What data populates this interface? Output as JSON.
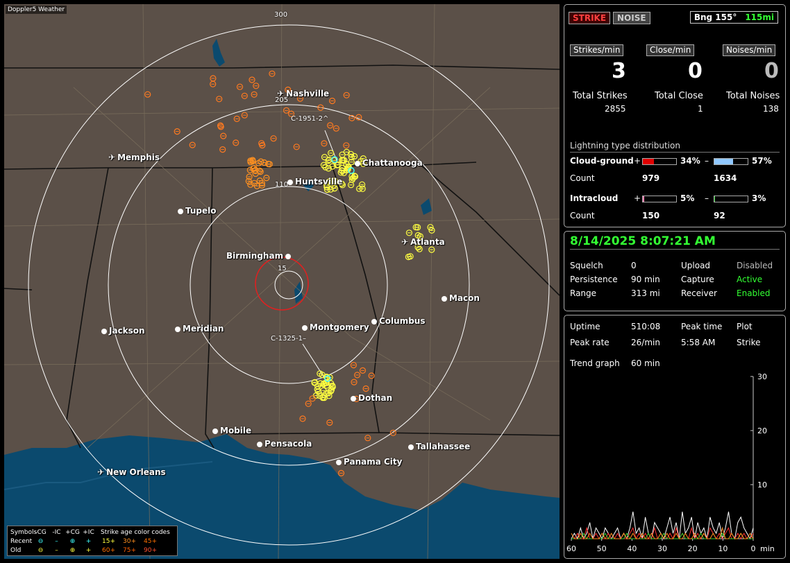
{
  "app": {
    "title": "Doppler5 Weather"
  },
  "map": {
    "range_labels": [
      "300",
      "205",
      "110",
      "15"
    ],
    "storm_labels": [
      "C-1951-2^",
      "C-1325-1–"
    ],
    "cities": [
      {
        "name": "Nashville",
        "airport": true
      },
      {
        "name": "Memphis",
        "airport": true
      },
      {
        "name": "Chattanooga",
        "airport": false
      },
      {
        "name": "Huntsville",
        "airport": false
      },
      {
        "name": "Tupelo",
        "airport": false
      },
      {
        "name": "Atlanta",
        "airport": true
      },
      {
        "name": "Birmingham",
        "airport": false
      },
      {
        "name": "Macon",
        "airport": false
      },
      {
        "name": "Jackson",
        "airport": false
      },
      {
        "name": "Meridian",
        "airport": false
      },
      {
        "name": "Montgomery",
        "airport": false
      },
      {
        "name": "Columbus",
        "airport": false
      },
      {
        "name": "Dothan",
        "airport": false
      },
      {
        "name": "Mobile",
        "airport": false
      },
      {
        "name": "Pensacola",
        "airport": false
      },
      {
        "name": "Tallahassee",
        "airport": false
      },
      {
        "name": "Panama City",
        "airport": false
      },
      {
        "name": "New Orleans",
        "airport": true
      }
    ]
  },
  "legend": {
    "header": [
      "Symbols",
      "-CG",
      "-IC",
      "+CG",
      "+IC",
      "Strike age color codes"
    ],
    "recent_label": "Recent",
    "old_label": "Old",
    "recent_ages": [
      "15+",
      "30+",
      "45+"
    ],
    "old_ages": [
      "60+",
      "75+",
      "90+"
    ],
    "age_colors": [
      "#ffff40",
      "#ff9020",
      "#ff7000",
      "#ff7000",
      "#ff6000",
      "#ff5030"
    ]
  },
  "status": {
    "strike_btn": "STRIKE",
    "noise_btn": "NOISE",
    "bearing": "Bng 155°",
    "distance": "115mi"
  },
  "rates": {
    "strikes_label": "Strikes/min",
    "close_label": "Close/min",
    "noises_label": "Noises/min",
    "strikes": "3",
    "close": "0",
    "noises": "0"
  },
  "totals": {
    "strikes_label": "Total Strikes",
    "close_label": "Total Close",
    "noises_label": "Total Noises",
    "strikes": "2855",
    "close": "1",
    "noises": "138"
  },
  "distribution": {
    "title": "Lightning type distribution",
    "cg_label": "Cloud-ground",
    "ic_label": "Intracloud",
    "count_label": "Count",
    "plus": "+",
    "minus": "–",
    "cg_plus_pct": "34%",
    "cg_minus_pct": "57%",
    "cg_plus_count": "979",
    "cg_minus_count": "1634",
    "ic_plus_pct": "5%",
    "ic_minus_pct": "3%",
    "ic_plus_count": "150",
    "ic_minus_count": "92",
    "cg_plus_fill": 0.34,
    "cg_minus_fill": 0.57,
    "ic_plus_fill": 0.05,
    "ic_minus_fill": 0.03,
    "colors": {
      "cg_plus": "#e00000",
      "cg_minus": "#90c8ff",
      "ic_plus": "#ff80b0",
      "ic_minus": "#30d030"
    }
  },
  "settings": {
    "datetime": "8/14/2025 8:07:21 AM",
    "squelch_label": "Squelch",
    "squelch": "0",
    "persistence_label": "Persistence",
    "persistence": "90 min",
    "range_label": "Range",
    "range": "313 mi",
    "upload_label": "Upload",
    "upload": "Disabled",
    "capture_label": "Capture",
    "capture": "Active",
    "receiver_label": "Receiver",
    "receiver": "Enabled"
  },
  "stats": {
    "uptime_label": "Uptime",
    "uptime": "510:08",
    "peak_time_label": "Peak time",
    "peak_time": "5:58 AM",
    "plot_label": "Plot",
    "plot": "Strike",
    "peak_rate_label": "Peak rate",
    "peak_rate": "26/min",
    "trend_label": "Trend graph",
    "trend": "60 min"
  },
  "chart_data": {
    "type": "line",
    "title": "",
    "xlabel": "min",
    "ylabel": "",
    "x_ticks": [
      "60",
      "50",
      "40",
      "30",
      "20",
      "10",
      "0"
    ],
    "y_ticks": [
      "30",
      "20",
      "10"
    ],
    "xlim": [
      60,
      0
    ],
    "ylim": [
      0,
      30
    ],
    "series": [
      {
        "color": "#ffffff",
        "values": [
          0,
          1,
          0,
          2,
          0,
          1,
          3,
          0,
          2,
          1,
          0,
          2,
          1,
          0,
          1,
          2,
          0,
          1,
          0,
          2,
          5,
          1,
          2,
          0,
          4,
          1,
          0,
          3,
          2,
          1,
          0,
          2,
          4,
          1,
          3,
          0,
          5,
          1,
          2,
          4,
          0,
          3,
          1,
          2,
          0,
          4,
          2,
          1,
          3,
          0,
          2,
          5,
          1,
          0,
          3,
          4,
          2,
          1,
          0,
          2
        ]
      },
      {
        "color": "#ff3030",
        "values": [
          0,
          0,
          1,
          0,
          0,
          2,
          0,
          0,
          1,
          0,
          0,
          0,
          1,
          0,
          0,
          1,
          0,
          0,
          0,
          1,
          2,
          0,
          1,
          0,
          1,
          0,
          0,
          2,
          0,
          0,
          1,
          0,
          1,
          0,
          2,
          0,
          1,
          0,
          0,
          2,
          0,
          1,
          0,
          1,
          0,
          2,
          1,
          0,
          1,
          0,
          1,
          2,
          0,
          0,
          1,
          0,
          1,
          0,
          0,
          1
        ]
      },
      {
        "color": "#30d030",
        "values": [
          0,
          0,
          0,
          0,
          1,
          0,
          0,
          0,
          0,
          0,
          0,
          1,
          0,
          0,
          0,
          0,
          0,
          0,
          1,
          0,
          0,
          0,
          0,
          0,
          0,
          1,
          0,
          0,
          0,
          0,
          1,
          0,
          0,
          0,
          0,
          0,
          1,
          0,
          0,
          0,
          0,
          0,
          1,
          0,
          0,
          0,
          0,
          0,
          0,
          1,
          0,
          0,
          0,
          0,
          0,
          1,
          0,
          0,
          0,
          0
        ]
      },
      {
        "color": "#ff9020",
        "values": [
          1,
          0,
          0,
          1,
          0,
          0,
          1,
          0,
          0,
          0,
          1,
          0,
          0,
          1,
          0,
          0,
          0,
          1,
          0,
          0,
          1,
          0,
          0,
          1,
          0,
          0,
          1,
          0,
          0,
          1,
          0,
          1,
          0,
          0,
          1,
          0,
          0,
          1,
          0,
          0,
          1,
          0,
          0,
          1,
          0,
          0,
          1,
          0,
          0,
          2,
          0,
          0,
          1,
          0,
          0,
          1,
          0,
          0,
          1,
          0
        ]
      }
    ]
  }
}
